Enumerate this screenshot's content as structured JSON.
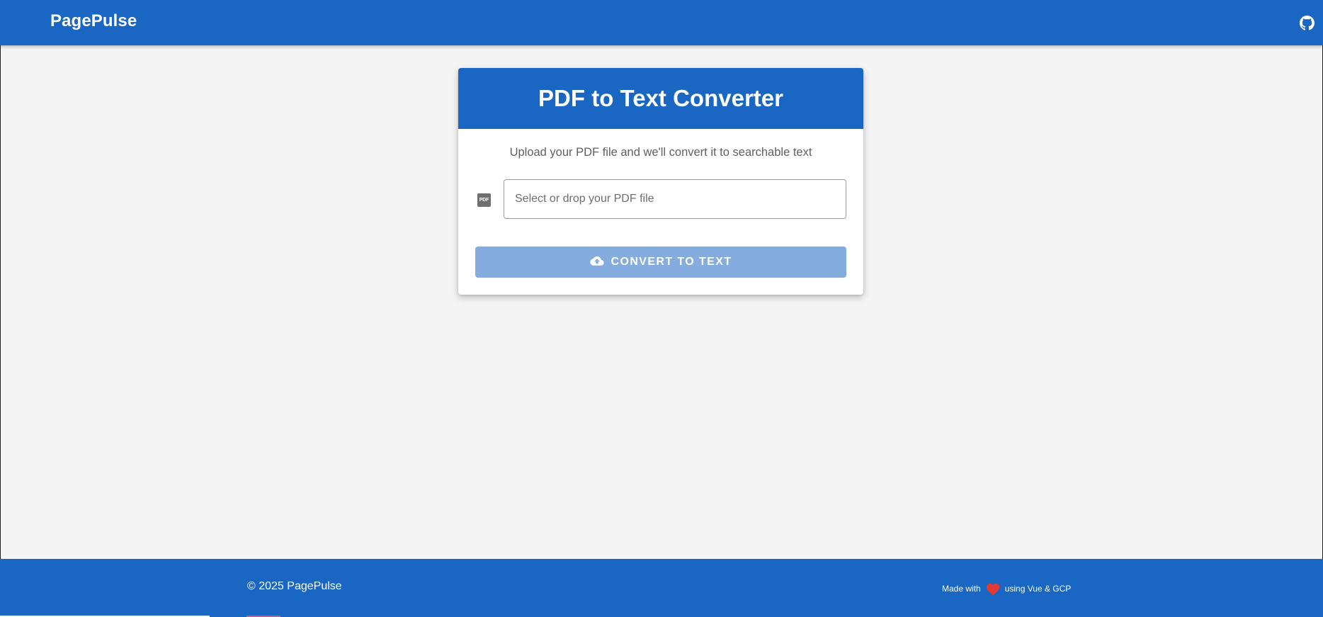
{
  "header": {
    "brand": "PagePulse",
    "github_icon": "github-icon"
  },
  "card": {
    "title": "PDF to Text Converter",
    "subtitle": "Upload your PDF file and we'll convert it to searchable text",
    "file_icon": "pdf-file-icon",
    "file_icon_text": "PDF",
    "file_input_placeholder": "Select or drop your PDF file",
    "convert_icon": "cloud-upload-icon",
    "convert_label": "CONVERT TO TEXT"
  },
  "footer": {
    "copyright": "© 2025 PagePulse",
    "made_with_prefix": "Made with",
    "heart_icon": "heart-icon",
    "made_with_suffix": "using Vue & GCP"
  },
  "colors": {
    "primary": "#1a67c3",
    "button_disabled": "#85acdf",
    "heart": "#e53935",
    "background": "#f4f4f4"
  }
}
